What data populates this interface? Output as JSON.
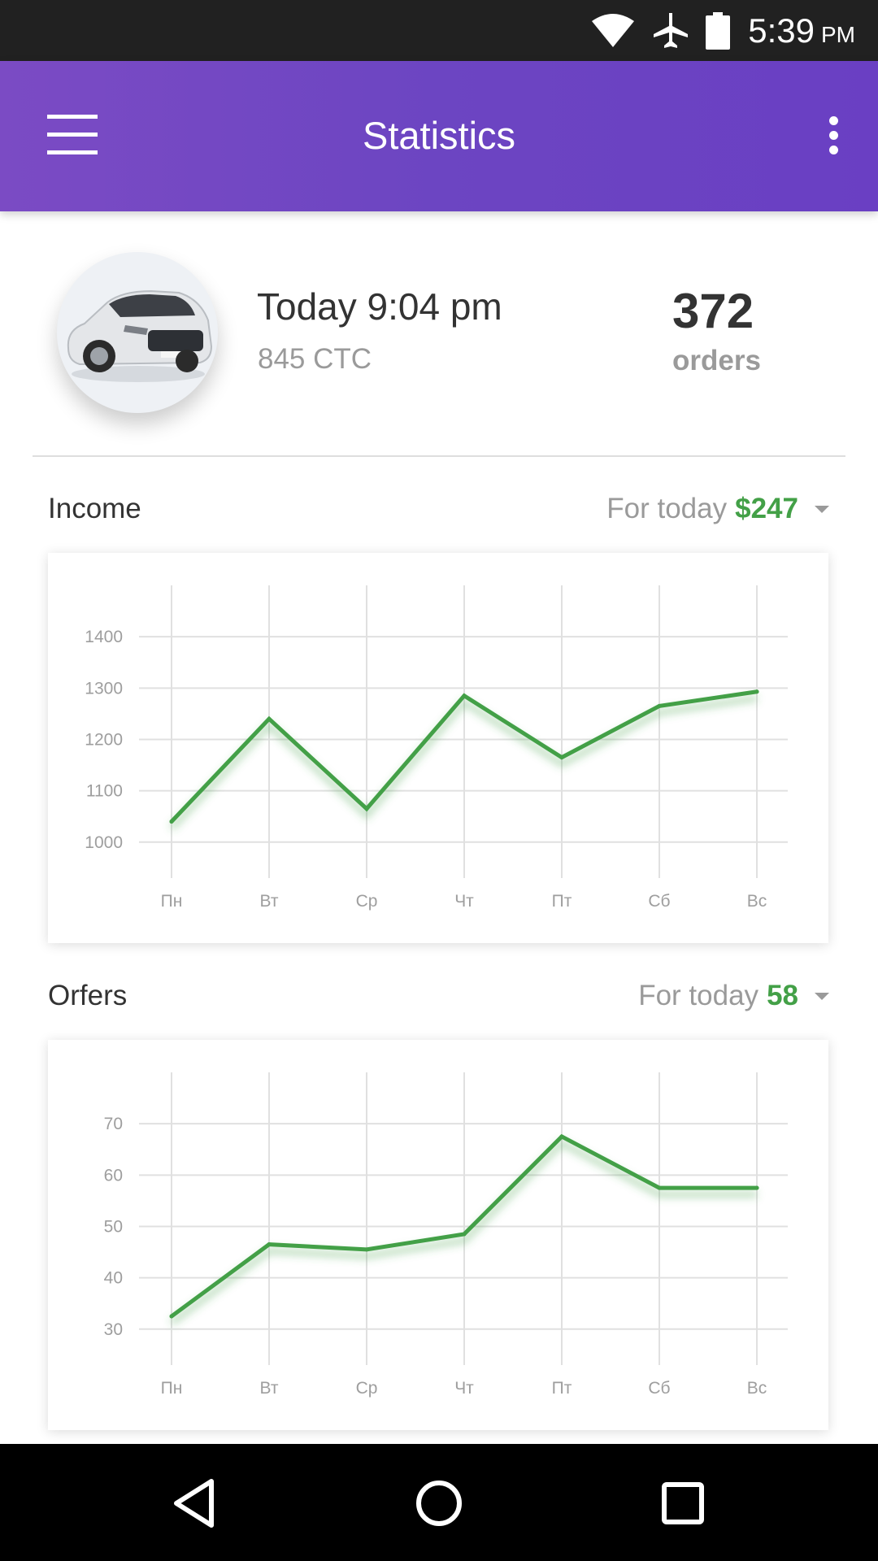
{
  "status_bar": {
    "time": "5:39",
    "ampm": "PM"
  },
  "app_bar": {
    "title": "Statistics"
  },
  "summary": {
    "time": "Today 9:04 pm",
    "plate": "845 CTC",
    "orders_count": "372",
    "orders_label": "orders"
  },
  "income": {
    "title": "Income",
    "period_label": "For today",
    "period_value": "$247"
  },
  "orders": {
    "title": "Orfers",
    "period_label": "For today",
    "period_value": "58"
  },
  "colors": {
    "accent": "#43a047",
    "app_bar": "#6c45c2"
  },
  "chart_data": [
    {
      "type": "line",
      "categories": [
        "Пн",
        "Вт",
        "Ср",
        "Чт",
        "Пт",
        "Сб",
        "Вс"
      ],
      "yticks": [
        1000,
        1100,
        1200,
        1300,
        1400
      ],
      "ylim": [
        930,
        1500
      ],
      "values": [
        1040,
        1240,
        1065,
        1285,
        1165,
        1265,
        1293
      ],
      "grid": true
    },
    {
      "type": "line",
      "categories": [
        "Пн",
        "Вт",
        "Ср",
        "Чт",
        "Пт",
        "Сб",
        "Вс"
      ],
      "yticks": [
        30,
        40,
        50,
        60,
        70
      ],
      "ylim": [
        23,
        80
      ],
      "values": [
        32.5,
        46.5,
        45.5,
        48.5,
        67.5,
        57.5,
        57.5
      ],
      "grid": true
    }
  ]
}
